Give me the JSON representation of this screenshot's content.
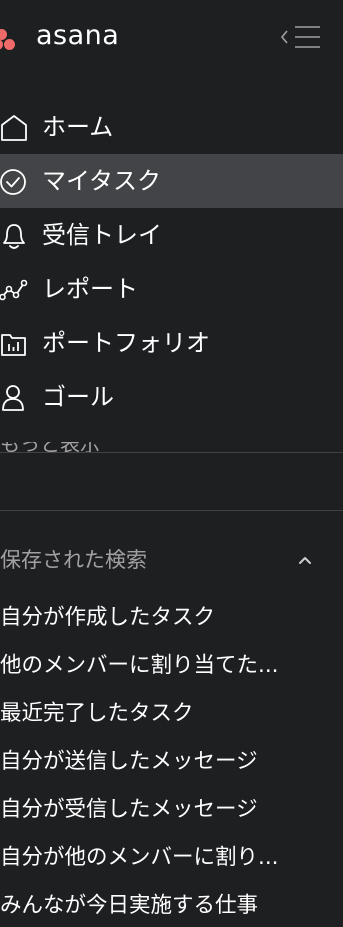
{
  "app": {
    "name": "asana",
    "brand_color": "#f06a6a"
  },
  "header": {
    "logo_text": "asana",
    "collapse_icon": "collapse-sidebar-icon"
  },
  "nav": {
    "items": [
      {
        "label": "ホーム",
        "icon": "home-icon"
      },
      {
        "label": "マイタスク",
        "icon": "check-circle-icon",
        "active": true
      },
      {
        "label": "受信トレイ",
        "icon": "bell-icon"
      },
      {
        "label": "レポート",
        "icon": "reporting-icon"
      },
      {
        "label": "ポートフォリオ",
        "icon": "portfolio-icon"
      },
      {
        "label": "ゴール",
        "icon": "goal-icon"
      }
    ],
    "more_label": "もっと表示"
  },
  "saved_searches": {
    "title": "保存された検索",
    "items": [
      "自分が作成したタスク",
      "他のメンバーに割り当てた...",
      "最近完了したタスク",
      "自分が送信したメッセージ",
      "自分が受信したメッセージ",
      "自分が他のメンバーに割り...",
      "みんなが今日実施する仕事"
    ]
  },
  "colors": {
    "background": "#1e1f21",
    "active_item": "#434447",
    "muted_text": "#a2a0a2"
  }
}
